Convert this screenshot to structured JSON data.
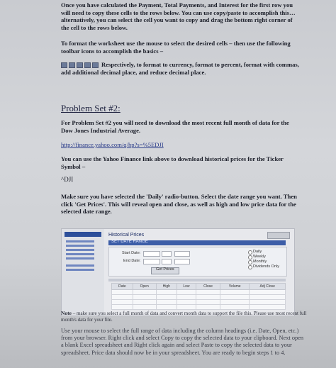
{
  "paragraphs": {
    "p1": "Once you have calculated the Payment, Total Payments, and Interest for the first row you will need to copy these cells to the rows below. You can use copy/paste to accomplish this… alternatively, you can select the cell you want to copy and drag the bottom right corner of the cell to the rows below.",
    "p2": "To format the worksheet use the mouse to select the desired cells – then use the following toolbar icons to accomplish the basics –",
    "p3": "Respectively, to format to currency, format to percent, format with commas, add additional decimal place, and reduce decimal place.",
    "heading": "Problem Set #2:",
    "p4": "For Problem Set #2 you will need to download the most recent full month of data for the Dow Jones Industrial Average.",
    "link": "http://finance.yahoo.com/q/hp?s=%5EDJI",
    "p5": "You can use the Yahoo Finance link above to download historical prices for the Ticker Symbol –",
    "ticker": "^DJI",
    "p6": "Make sure you have selected the 'Daily' radio-button. Select the date range you want. Then click 'Get Prices'. This will reveal open and close, as well as high and low price data for the selected date range.",
    "note_label": "Note",
    "note": "– make sure you select a full month of data and convert month data to support the file this. Please use most recent full month's data for your file.",
    "p7": "Use your mouse to select the full range of data including the column headings (i.e. Date, Open, etc.) from your browser. Right click and select Copy to copy the selected data to your clipboard. Next open a blank Excel spreadsheet and Right click again and select Paste to copy the selected data to your spreadsheet. Price data should now be in your spreadsheet. You are ready to begin steps 1 to 4."
  },
  "toolbar_icons": [
    "currency-icon",
    "percent-icon",
    "comma-icon",
    "increase-decimal-icon",
    "decrease-decimal-icon"
  ],
  "screenshot": {
    "title": "Historical Prices",
    "bar_label": "SET DATE RANGE",
    "start_label": "Start Date:",
    "end_label": "End Date:",
    "radio_daily": "Daily",
    "radio_weekly": "Weekly",
    "radio_monthly": "Monthly",
    "radio_dividends": "Dividends Only",
    "button": "Get Prices",
    "table_headers": [
      "Date",
      "Open",
      "High",
      "Low",
      "Close",
      "Volume",
      "Adj Close"
    ]
  }
}
